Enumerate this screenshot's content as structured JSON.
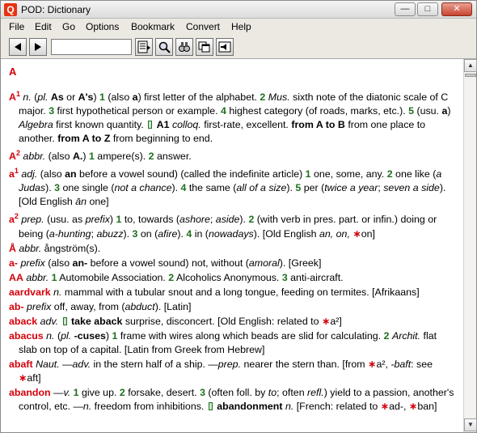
{
  "window": {
    "icon_letter": "Q",
    "title": "POD: Dictionary",
    "minimize_glyph": "—",
    "maximize_glyph": "□",
    "close_glyph": "✕"
  },
  "menu": [
    "File",
    "Edit",
    "Go",
    "Options",
    "Bookmark",
    "Convert",
    "Help"
  ],
  "search": {
    "value": ""
  },
  "content": {
    "section_heading": "A",
    "entries": [
      [
        {
          "c": "hw",
          "t": "A"
        },
        {
          "c": "sup hw",
          "t": "1"
        },
        {
          "t": "  "
        },
        {
          "c": "pos",
          "t": "n."
        },
        {
          "t": " ("
        },
        {
          "c": "pos",
          "t": "pl."
        },
        {
          "t": " "
        },
        {
          "c": "b",
          "t": "As"
        },
        {
          "t": " or "
        },
        {
          "c": "b",
          "t": "A's"
        },
        {
          "t": ") "
        },
        {
          "c": "num",
          "t": "1"
        },
        {
          "t": " (also "
        },
        {
          "c": "b",
          "t": "a"
        },
        {
          "t": ") first letter of the alphabet. "
        },
        {
          "c": "num",
          "t": "2"
        },
        {
          "t": " "
        },
        {
          "c": "pos",
          "t": "Mus."
        },
        {
          "t": " sixth note of the diatonic scale of C major. "
        },
        {
          "c": "num",
          "t": "3"
        },
        {
          "t": " first hypothetical person or example. "
        },
        {
          "c": "num",
          "t": "4"
        },
        {
          "t": " highest category (of roads, marks, etc.). "
        },
        {
          "c": "num",
          "t": "5"
        },
        {
          "t": " (usu. "
        },
        {
          "c": "b",
          "t": "a"
        },
        {
          "t": ") "
        },
        {
          "c": "pos",
          "t": "Algebra"
        },
        {
          "t": " first known quantity. "
        },
        {
          "c": "bullet",
          "t": ""
        },
        {
          "t": " "
        },
        {
          "c": "b",
          "t": "A1"
        },
        {
          "t": " "
        },
        {
          "c": "pos",
          "t": "colloq."
        },
        {
          "t": " first-rate, excellent. "
        },
        {
          "c": "b",
          "t": "from A to B"
        },
        {
          "t": " from one place to another. "
        },
        {
          "c": "b",
          "t": "from A to Z"
        },
        {
          "t": " from beginning to end."
        }
      ],
      [
        {
          "c": "hw",
          "t": "A"
        },
        {
          "c": "sup hw",
          "t": "2"
        },
        {
          "t": "  "
        },
        {
          "c": "pos",
          "t": "abbr."
        },
        {
          "t": " (also "
        },
        {
          "c": "b",
          "t": "A."
        },
        {
          "t": ") "
        },
        {
          "c": "num",
          "t": "1"
        },
        {
          "t": " ampere(s). "
        },
        {
          "c": "num",
          "t": "2"
        },
        {
          "t": " answer."
        }
      ],
      [
        {
          "c": "hw",
          "t": "a"
        },
        {
          "c": "sup hw",
          "t": "1"
        },
        {
          "t": "  "
        },
        {
          "c": "pos",
          "t": "adj."
        },
        {
          "t": " (also "
        },
        {
          "c": "b",
          "t": "an"
        },
        {
          "t": " before a vowel sound) (called the indefinite article) "
        },
        {
          "c": "num",
          "t": "1"
        },
        {
          "t": " one, some, any. "
        },
        {
          "c": "num",
          "t": "2"
        },
        {
          "t": " one like ("
        },
        {
          "c": "pos",
          "t": "a Judas"
        },
        {
          "t": "). "
        },
        {
          "c": "num",
          "t": "3"
        },
        {
          "t": " one single ("
        },
        {
          "c": "pos",
          "t": "not a chance"
        },
        {
          "t": "). "
        },
        {
          "c": "num",
          "t": "4"
        },
        {
          "t": " the same ("
        },
        {
          "c": "pos",
          "t": "all of a size"
        },
        {
          "t": "). "
        },
        {
          "c": "num",
          "t": "5"
        },
        {
          "t": " per ("
        },
        {
          "c": "pos",
          "t": "twice a year"
        },
        {
          "t": "; "
        },
        {
          "c": "pos",
          "t": "seven a side"
        },
        {
          "t": "). [Old English "
        },
        {
          "c": "pos",
          "t": "ān"
        },
        {
          "t": " one]"
        }
      ],
      [
        {
          "c": "hw",
          "t": "a"
        },
        {
          "c": "sup hw",
          "t": "2"
        },
        {
          "t": "  "
        },
        {
          "c": "pos",
          "t": "prep."
        },
        {
          "t": " (usu. as "
        },
        {
          "c": "pos",
          "t": "prefix"
        },
        {
          "t": ") "
        },
        {
          "c": "num",
          "t": "1"
        },
        {
          "t": " to, towards ("
        },
        {
          "c": "pos",
          "t": "ashore"
        },
        {
          "t": "; "
        },
        {
          "c": "pos",
          "t": "aside"
        },
        {
          "t": "). "
        },
        {
          "c": "num",
          "t": "2"
        },
        {
          "t": " (with verb in pres. part. or infin.) doing or being ("
        },
        {
          "c": "pos",
          "t": "a-hunting"
        },
        {
          "t": "; "
        },
        {
          "c": "pos",
          "t": "abuzz"
        },
        {
          "t": "). "
        },
        {
          "c": "num",
          "t": "3"
        },
        {
          "t": " on ("
        },
        {
          "c": "pos",
          "t": "afire"
        },
        {
          "t": "). "
        },
        {
          "c": "num",
          "t": "4"
        },
        {
          "t": " in ("
        },
        {
          "c": "pos",
          "t": "nowadays"
        },
        {
          "t": "). [Old English "
        },
        {
          "c": "pos",
          "t": "an, on,"
        },
        {
          "t": " "
        },
        {
          "c": "xref",
          "t": "∗"
        },
        {
          "t": "on]"
        }
      ],
      [
        {
          "c": "hw",
          "t": "Å"
        },
        {
          "t": "  "
        },
        {
          "c": "pos",
          "t": "abbr."
        },
        {
          "t": " ångström(s)."
        }
      ],
      [
        {
          "c": "hw",
          "t": "a-"
        },
        {
          "t": "  "
        },
        {
          "c": "pos",
          "t": "prefix"
        },
        {
          "t": " (also "
        },
        {
          "c": "b",
          "t": "an-"
        },
        {
          "t": " before a vowel sound) not, without ("
        },
        {
          "c": "pos",
          "t": "amoral"
        },
        {
          "t": "). [Greek]"
        }
      ],
      [
        {
          "c": "hw",
          "t": "AA"
        },
        {
          "t": "  "
        },
        {
          "c": "pos",
          "t": "abbr."
        },
        {
          "t": " "
        },
        {
          "c": "num",
          "t": "1"
        },
        {
          "t": " Automobile Association. "
        },
        {
          "c": "num",
          "t": "2"
        },
        {
          "t": " Alcoholics Anonymous. "
        },
        {
          "c": "num",
          "t": "3"
        },
        {
          "t": " anti-aircraft."
        }
      ],
      [
        {
          "c": "hw",
          "t": "aardvark"
        },
        {
          "t": "  "
        },
        {
          "c": "pos",
          "t": "n."
        },
        {
          "t": " mammal with a tubular snout and a long tongue, feeding on termites. [Afrikaans]"
        }
      ],
      [
        {
          "c": "hw",
          "t": "ab-"
        },
        {
          "t": "  "
        },
        {
          "c": "pos",
          "t": "prefix"
        },
        {
          "t": " off, away, from ("
        },
        {
          "c": "pos",
          "t": "abduct"
        },
        {
          "t": "). [Latin]"
        }
      ],
      [
        {
          "c": "hw",
          "t": "aback"
        },
        {
          "t": "  "
        },
        {
          "c": "pos",
          "t": "adv."
        },
        {
          "t": " "
        },
        {
          "c": "bullet",
          "t": ""
        },
        {
          "t": "  "
        },
        {
          "c": "b",
          "t": "take aback"
        },
        {
          "t": " surprise, disconcert. [Old English: related to "
        },
        {
          "c": "xref",
          "t": "∗"
        },
        {
          "t": "a²]"
        }
      ],
      [
        {
          "c": "hw",
          "t": "abacus"
        },
        {
          "t": "  "
        },
        {
          "c": "pos",
          "t": "n."
        },
        {
          "t": " ("
        },
        {
          "c": "pos",
          "t": "pl."
        },
        {
          "t": " "
        },
        {
          "c": "b",
          "t": "-cuses"
        },
        {
          "t": ") "
        },
        {
          "c": "num",
          "t": "1"
        },
        {
          "t": " frame with wires along which beads are slid for calculating. "
        },
        {
          "c": "num",
          "t": "2"
        },
        {
          "t": " "
        },
        {
          "c": "pos",
          "t": "Archit."
        },
        {
          "t": " flat slab on top of a capital. [Latin from Greek from Hebrew]"
        }
      ],
      [
        {
          "c": "hw",
          "t": "abaft"
        },
        {
          "t": "  "
        },
        {
          "c": "pos",
          "t": "Naut."
        },
        {
          "t": " —"
        },
        {
          "c": "pos",
          "t": "adv."
        },
        {
          "t": " in the stern half of a ship. —"
        },
        {
          "c": "pos",
          "t": "prep."
        },
        {
          "t": " nearer the stern than. [from "
        },
        {
          "c": "xref",
          "t": "∗"
        },
        {
          "t": "a², "
        },
        {
          "c": "pos",
          "t": "-baft"
        },
        {
          "t": ": see "
        },
        {
          "c": "xref",
          "t": "∗"
        },
        {
          "t": "aft]"
        }
      ],
      [
        {
          "c": "hw",
          "t": "abandon"
        },
        {
          "t": "  —"
        },
        {
          "c": "pos",
          "t": "v."
        },
        {
          "t": " "
        },
        {
          "c": "num",
          "t": "1"
        },
        {
          "t": " give up. "
        },
        {
          "c": "num",
          "t": "2"
        },
        {
          "t": " forsake, desert. "
        },
        {
          "c": "num",
          "t": "3"
        },
        {
          "t": " (often foll. by "
        },
        {
          "c": "pos",
          "t": "to"
        },
        {
          "t": "; often "
        },
        {
          "c": "pos",
          "t": "refl."
        },
        {
          "t": ") yield to a passion, another's control, etc. —"
        },
        {
          "c": "pos",
          "t": "n."
        },
        {
          "t": " freedom from inhibitions. "
        },
        {
          "c": "bullet",
          "t": ""
        },
        {
          "t": "  "
        },
        {
          "c": "b",
          "t": "abandonment"
        },
        {
          "t": " "
        },
        {
          "c": "pos",
          "t": "n."
        },
        {
          "t": " [French: related to "
        },
        {
          "c": "xref",
          "t": "∗"
        },
        {
          "t": "ad-, "
        },
        {
          "c": "xref",
          "t": "∗"
        },
        {
          "t": "ban]"
        }
      ]
    ]
  },
  "colors": {
    "headword": "#d4000a",
    "sense_number": "#1f6f1f",
    "titlebar_close": "#c8442e"
  }
}
